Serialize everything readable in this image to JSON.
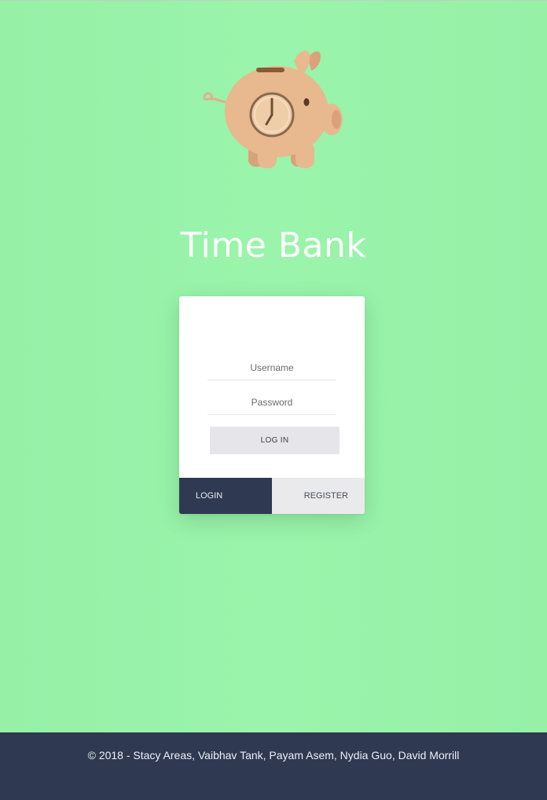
{
  "app": {
    "title": "Time Bank"
  },
  "logo": {
    "icon": "piggy-bank-clock-icon",
    "colors": {
      "body": "#e8b88f",
      "shade": "#d9a27a",
      "clock_face": "#efcda8",
      "clock_ring": "#8a6a4e",
      "slot": "#8a5a36"
    }
  },
  "login_form": {
    "username": {
      "placeholder": "Username",
      "value": ""
    },
    "password": {
      "placeholder": "Password",
      "value": ""
    },
    "submit_label": "LOG IN"
  },
  "tabs": [
    {
      "label": "LOGIN",
      "active": true
    },
    {
      "label": "REGISTER",
      "active": false
    }
  ],
  "footer": {
    "text": "© 2018 - Stacy Areas, Vaibhav Tank, Payam Asem, Nydia Guo, David Morrill"
  },
  "colors": {
    "background": "#96f2a8",
    "navy": "#2f3952",
    "button_gray": "#e6e6ea"
  }
}
